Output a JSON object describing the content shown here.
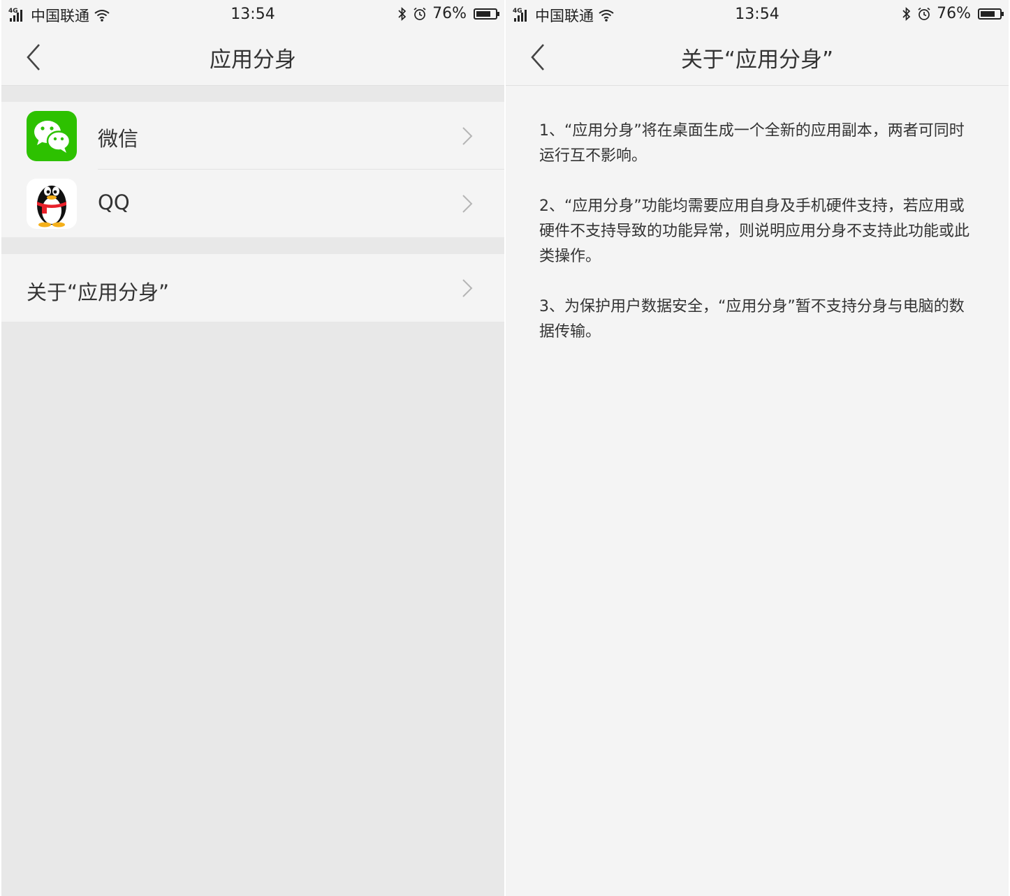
{
  "status_bar": {
    "network": "4G",
    "carrier": "中国联通",
    "time": "13:54",
    "battery_percent": "76%",
    "battery_level": 0.76
  },
  "left_screen": {
    "title": "应用分身",
    "apps": [
      {
        "name": "微信",
        "icon": "wechat-icon"
      },
      {
        "name": "QQ",
        "icon": "qq-penguin-icon"
      }
    ],
    "about_label": "关于“应用分身”"
  },
  "right_screen": {
    "title": "关于“应用分身”",
    "paragraphs": [
      "1、“应用分身”将在桌面生成一个全新的应用副本，两者可同时运行互不影响。",
      "2、“应用分身”功能均需要应用自身及手机硬件支持，若应用或硬件不支持导致的功能异常，则说明应用分身不支持此功能或此类操作。",
      "3、为保护用户数据安全，“应用分身”暂不支持分身与电脑的数据传输。"
    ]
  },
  "colors": {
    "wechat_green": "#2dc100",
    "qq_red": "#e8202a",
    "qq_yellow": "#f5b01a"
  }
}
